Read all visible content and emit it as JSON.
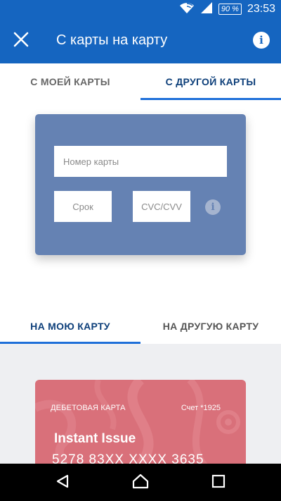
{
  "status_bar": {
    "battery": "90 %",
    "time": "23:53",
    "icons": [
      "wifi-icon",
      "signal-icon",
      "battery-icon"
    ]
  },
  "app_bar": {
    "title": "С карты на карту",
    "close_icon": "close-icon",
    "info_icon": "info-icon",
    "info_glyph": "i"
  },
  "source_tabs": [
    {
      "label": "С МОЕЙ КАРТЫ",
      "active": false
    },
    {
      "label": "С ДРУГОЙ КАРТЫ",
      "active": true
    }
  ],
  "source_form": {
    "card_number_placeholder": "Номер карты",
    "expiry_placeholder": "Срок",
    "cvc_placeholder": "CVC/CVV",
    "cvc_info_glyph": "i"
  },
  "destination_tabs": [
    {
      "label": "НА МОЮ КАРТУ",
      "active": true
    },
    {
      "label": "НА ДРУГУЮ КАРТУ",
      "active": false
    }
  ],
  "destination_card": {
    "type": "ДЕБЕТОВАЯ КАРТА",
    "account": "Счет *1925",
    "name": "Instant Issue",
    "number": "5278 83XX XXXX 3635"
  },
  "nav_bar": {
    "icons": [
      "back-icon",
      "home-icon",
      "recent-apps-icon"
    ]
  },
  "colors": {
    "primary": "#1565c0",
    "tab_indicator": "#1e6fd9",
    "form_card": "#6582b3",
    "debit_card": "#d9707a",
    "dest_background": "#eeeff2"
  }
}
